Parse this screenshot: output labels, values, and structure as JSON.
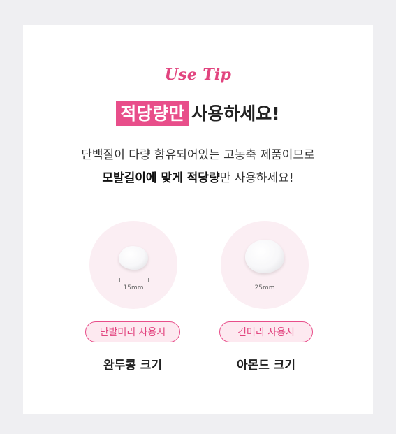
{
  "use_tip": "Use Tip",
  "headline": {
    "highlight": "적당량만",
    "rest": "사용하세요!"
  },
  "description": {
    "line1": "단백질이 다량 함유되어있는 고농축 제품이므로",
    "line2_bold1": "모발길이에 맞게 적당량",
    "line2_rest": "만 사용하세요!"
  },
  "items": [
    {
      "size": "15mm",
      "label": "단발머리 사용시",
      "caption": "완두콩 크기"
    },
    {
      "size": "25mm",
      "label": "긴머리 사용시",
      "caption": "아몬드 크기"
    }
  ],
  "colors": {
    "accent": "#e84e8a",
    "circle_bg": "#fbeef3",
    "page_bg": "#efeff2"
  }
}
